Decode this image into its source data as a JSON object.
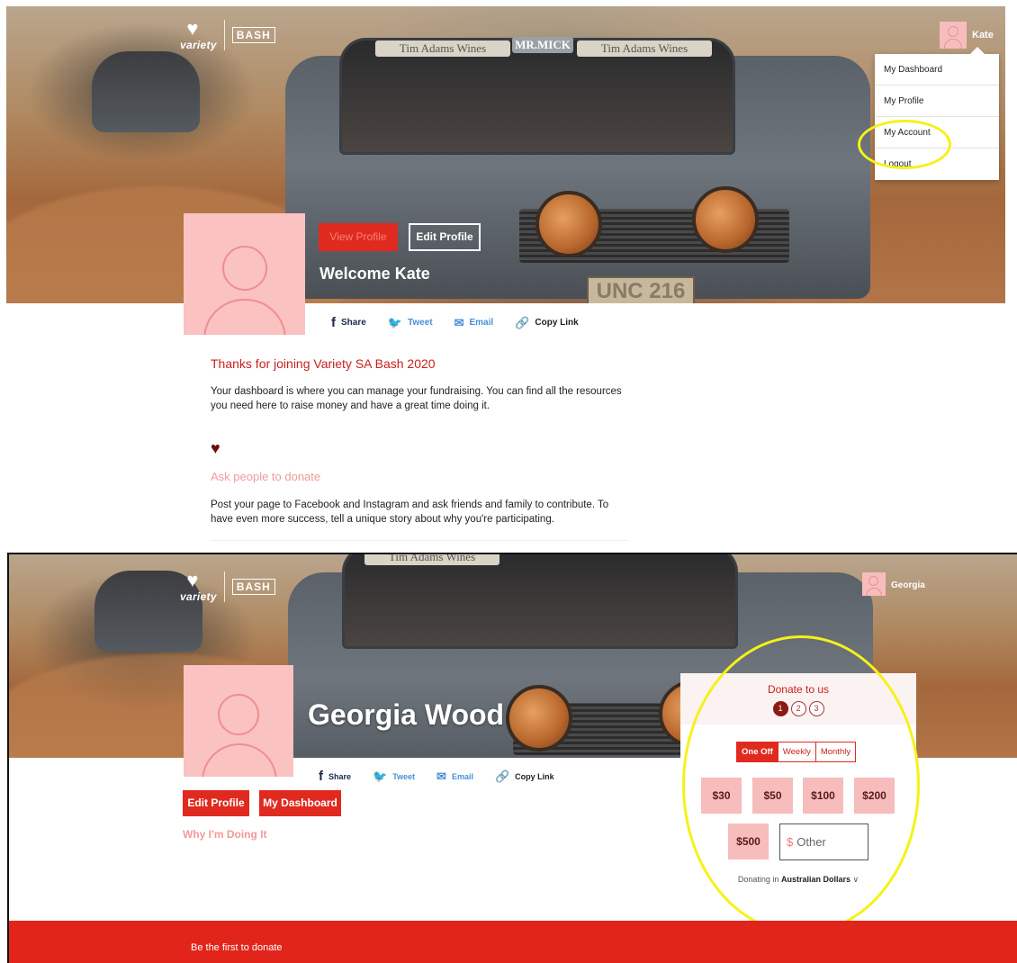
{
  "top_panel": {
    "user_name": "Kate",
    "dropdown": [
      "My Dashboard",
      "My Profile",
      "My Account",
      "Logout"
    ],
    "view_profile_label": "View Profile",
    "edit_profile_label": "Edit Profile",
    "welcome": "Welcome Kate",
    "thanks_heading": "Thanks for joining Variety SA Bash 2020",
    "intro_text": "Your dashboard is where you can manage your fundraising. You can find all the resources you need here to raise money and have a great time doing it.",
    "ask_heading": "Ask people to donate",
    "ask_text": "Post your page to Facebook and Instagram and ask friends and family to contribute. To have even more success, tell a unique story about why you're participating."
  },
  "share": {
    "share_label": "Share",
    "tweet_label": "Tweet",
    "email_label": "Email",
    "copy_link_label": "Copy Link"
  },
  "brand": {
    "variety": "variety",
    "bash": "BASH"
  },
  "hero_photo": {
    "sticker_1": "Tim Adams Wines",
    "sticker_2": "MR.MICK",
    "sticker_3": "Tim Adams Wines",
    "plate": "UNC 216"
  },
  "bottom_panel": {
    "user_name": "Georgia",
    "profile_name": "Georgia Wood",
    "edit_profile_label": "Edit Profile",
    "my_dashboard_label": "My Dashboard",
    "why_label": "Why I'm Doing It",
    "footer_text": "Be the first to donate"
  },
  "donate": {
    "title": "Donate to us",
    "steps": [
      "1",
      "2",
      "3"
    ],
    "frequencies": [
      "One Off",
      "Weekly",
      "Monthly"
    ],
    "amounts": [
      "$30",
      "$50",
      "$100",
      "$200",
      "$500"
    ],
    "other_currency_symbol": "$",
    "other_placeholder": "Other",
    "currency_prefix": "Donating in",
    "currency_name": "Australian Dollars",
    "currency_chevron": "∨"
  },
  "colors": {
    "accent_red": "#e12a1f",
    "pink": "#f7bcbc",
    "annotation_yellow": "#f6f11a"
  }
}
